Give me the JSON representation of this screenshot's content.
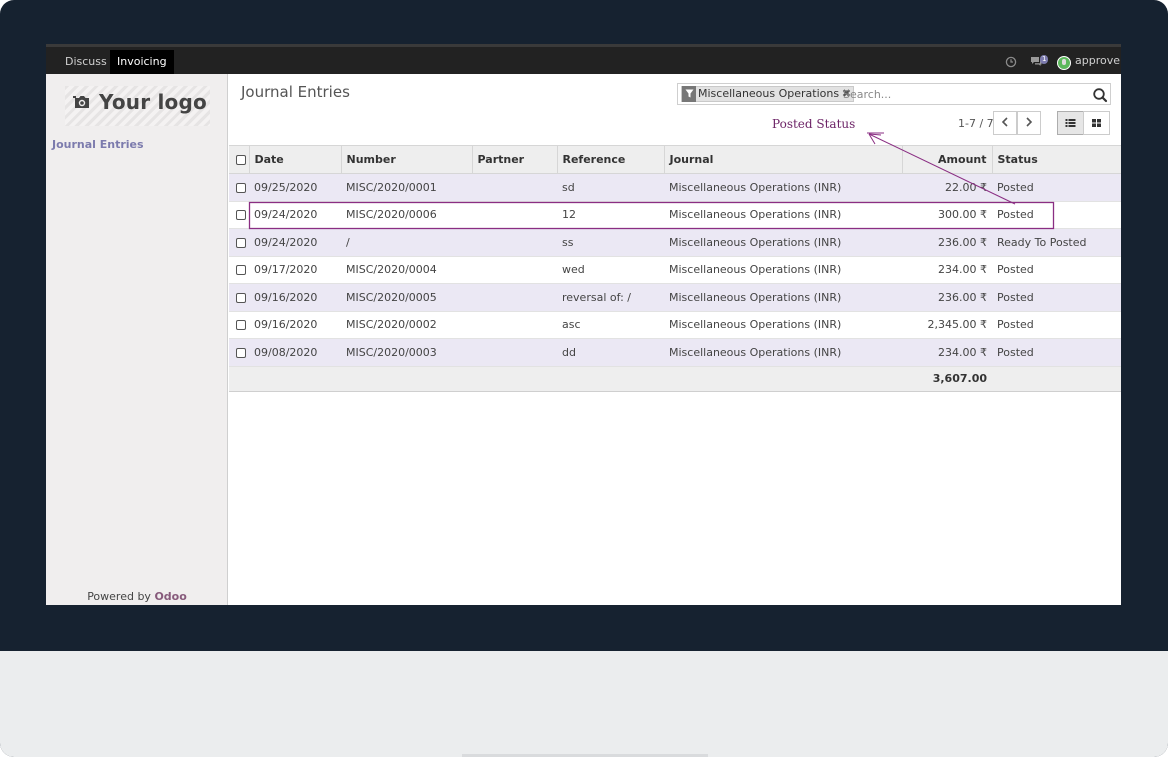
{
  "topbar": {
    "apps": [
      "Discuss",
      "Invoicing"
    ],
    "active_app": "Invoicing",
    "chat_badge": "1",
    "user": "approver"
  },
  "sidebar": {
    "logo_text": "Your logo",
    "menu": [
      "Journal Entries"
    ],
    "powered_prefix": "Powered by",
    "powered_brand": "Odoo"
  },
  "control": {
    "title": "Journal Entries",
    "facet": "Miscellaneous Operations",
    "search_placeholder": "Search...",
    "pager": "1-7 / 7",
    "annotation": "Posted  Status"
  },
  "table": {
    "columns": [
      "Date",
      "Number",
      "Partner",
      "Reference",
      "Journal",
      "Amount",
      "Status"
    ],
    "rows": [
      {
        "date": "09/25/2020",
        "number": "MISC/2020/0001",
        "partner": "",
        "reference": "sd",
        "journal": "Miscellaneous Operations (INR)",
        "amount": "22.00 ₹",
        "status": "Posted"
      },
      {
        "date": "09/24/2020",
        "number": "MISC/2020/0006",
        "partner": "",
        "reference": "12",
        "journal": "Miscellaneous Operations (INR)",
        "amount": "300.00 ₹",
        "status": "Posted"
      },
      {
        "date": "09/24/2020",
        "number": "/",
        "partner": "",
        "reference": "ss",
        "journal": "Miscellaneous Operations (INR)",
        "amount": "236.00 ₹",
        "status": "Ready To Posted"
      },
      {
        "date": "09/17/2020",
        "number": "MISC/2020/0004",
        "partner": "",
        "reference": "wed",
        "journal": "Miscellaneous Operations (INR)",
        "amount": "234.00 ₹",
        "status": "Posted"
      },
      {
        "date": "09/16/2020",
        "number": "MISC/2020/0005",
        "partner": "",
        "reference": "reversal of: /",
        "journal": "Miscellaneous Operations (INR)",
        "amount": "236.00 ₹",
        "status": "Posted"
      },
      {
        "date": "09/16/2020",
        "number": "MISC/2020/0002",
        "partner": "",
        "reference": "asc",
        "journal": "Miscellaneous Operations (INR)",
        "amount": "2,345.00 ₹",
        "status": "Posted"
      },
      {
        "date": "09/08/2020",
        "number": "MISC/2020/0003",
        "partner": "",
        "reference": "dd",
        "journal": "Miscellaneous Operations (INR)",
        "amount": "234.00 ₹",
        "status": "Posted"
      }
    ],
    "total": "3,607.00"
  },
  "colors": {
    "accent": "#7c7bad",
    "brand": "#875a7b",
    "annotation": "#6d2467",
    "row_stripe": "#ebe8f4"
  }
}
